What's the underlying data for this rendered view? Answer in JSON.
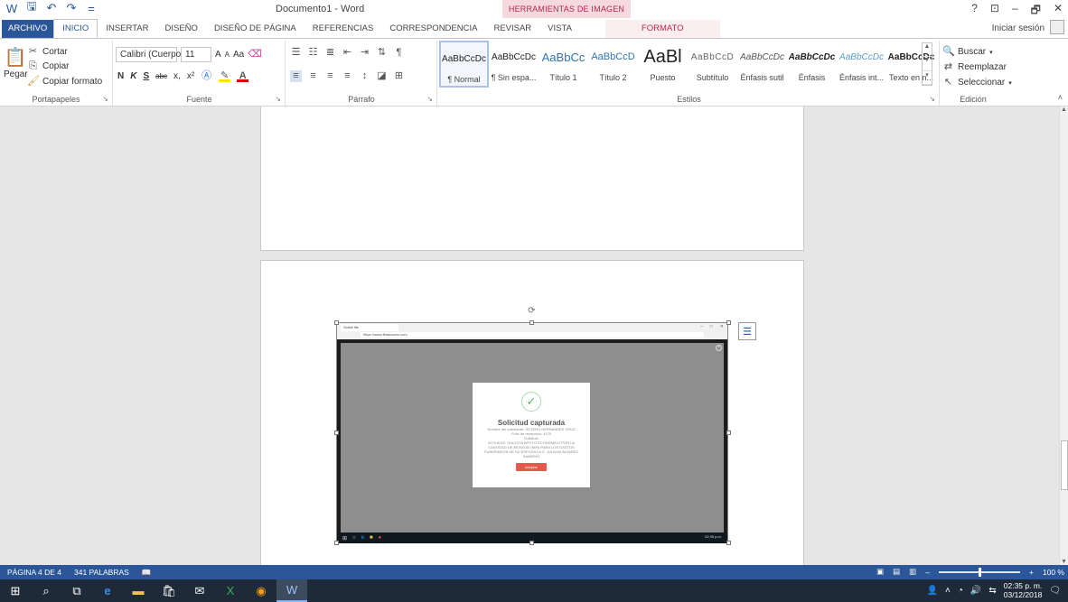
{
  "window": {
    "title": "Documento1 - Word",
    "context_tab_group": "HERRAMIENTAS DE IMAGEN",
    "help": "?",
    "controls": [
      "⊡",
      "–",
      "🗗",
      "✕"
    ]
  },
  "qat": {
    "word_icon": "word-icon",
    "save_icon": "save-icon",
    "undo_icon": "undo-icon",
    "redo_icon": "redo-icon",
    "customize": "="
  },
  "tabs": [
    "ARCHIVO",
    "INICIO",
    "INSERTAR",
    "DISEÑO",
    "DISEÑO DE PÁGINA",
    "REFERENCIAS",
    "CORRESPONDENCIA",
    "REVISAR",
    "VISTA",
    "FORMATO"
  ],
  "active_tab": "INICIO",
  "signin": "Iniciar sesión",
  "clipboard": {
    "paste": "Pegar",
    "cut": "Cortar",
    "copy": "Copiar",
    "format_painter": "Copiar formato",
    "label": "Portapapeles"
  },
  "font": {
    "family": "Calibri (Cuerpo",
    "size": "11",
    "grow": "A",
    "shrink": "A",
    "change_case": "Aa",
    "bold": "N",
    "italic": "K",
    "underline": "S",
    "strike": "abc",
    "subscript": "x,",
    "superscript": "x²",
    "label": "Fuente"
  },
  "paragraph": {
    "label": "Párrafo",
    "pilcrow": "¶"
  },
  "styles": {
    "label": "Estilos",
    "items": [
      {
        "preview": "AaBbCcDc",
        "name": "¶ Normal"
      },
      {
        "preview": "AaBbCcDc",
        "name": "¶ Sin espa..."
      },
      {
        "preview": "AaBbCc",
        "name": "Título 1"
      },
      {
        "preview": "AaBbCcD",
        "name": "Título 2"
      },
      {
        "preview": "AaBl",
        "name": "Puesto"
      },
      {
        "preview": "AaBbCcD",
        "name": "Subtítulo"
      },
      {
        "preview": "AaBbCcDc",
        "name": "Énfasis sutil"
      },
      {
        "preview": "AaBbCcDc",
        "name": "Énfasis"
      },
      {
        "preview": "AaBbCcDc",
        "name": "Énfasis int..."
      },
      {
        "preview": "AaBbCcDc",
        "name": "Texto en n..."
      }
    ]
  },
  "editing": {
    "find": "Buscar",
    "replace": "Reemplazar",
    "select": "Seleccionar",
    "label": "Edición"
  },
  "embedded": {
    "tab_title": "Solicit file",
    "url": "https://www.fbdacaceu.com",
    "modal_title": "Solicitud capturada",
    "modal_lines": [
      "Nombre del solicitante: SOTERO HERNÁNDEZ CRUZ",
      "Folio de recepción: 4179",
      "Solicitud:",
      "4179-8210: SOLICITA APOYO ECONÓMICO POR LA",
      "CANTIDAD DE $9,000.00 (M/N) PARA LOS GASTOS",
      "FUNERARIOS DE SU ESPOSA LA C. JULIANA ÁLVAREZ",
      "SAMIENO"
    ],
    "modal_button": "Aceptar",
    "taskbar_time": "02:35 p.m."
  },
  "status": {
    "page": "PÁGINA 4 DE 4",
    "words": "341 PALABRAS",
    "zoom": "100 %",
    "zoom_level": 1.0
  },
  "taskbar": {
    "time": "02:35 p. m.",
    "date": "03/12/2018"
  },
  "colors": {
    "word_blue": "#2b579a",
    "context_pink": "#b8244a",
    "taskbar": "#1f2a38"
  }
}
